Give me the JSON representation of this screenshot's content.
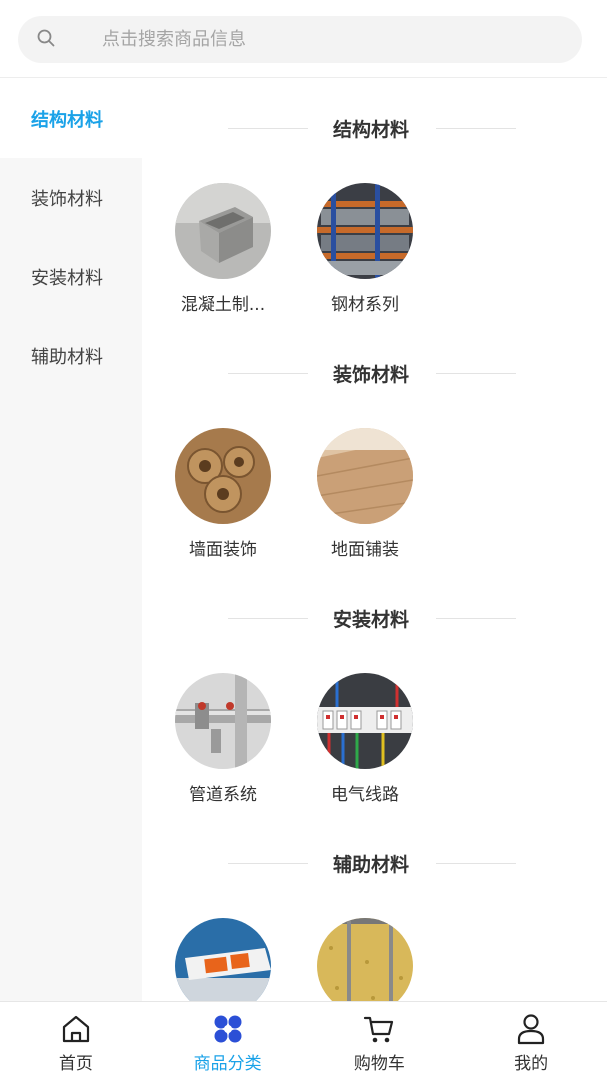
{
  "search": {
    "placeholder": "点击搜索商品信息",
    "icon": "search-icon"
  },
  "sidebar": {
    "items": [
      {
        "label": "结构材料",
        "active": true
      },
      {
        "label": "装饰材料",
        "active": false
      },
      {
        "label": "安装材料",
        "active": false
      },
      {
        "label": "辅助材料",
        "active": false
      }
    ]
  },
  "sections": [
    {
      "title": "结构材料",
      "items": [
        {
          "label": "混凝土制..."
        },
        {
          "label": "钢材系列"
        }
      ]
    },
    {
      "title": "装饰材料",
      "items": [
        {
          "label": "墙面装饰"
        },
        {
          "label": "地面铺装"
        }
      ]
    },
    {
      "title": "安装材料",
      "items": [
        {
          "label": "管道系统"
        },
        {
          "label": "电气线路"
        }
      ]
    },
    {
      "title": "辅助材料",
      "items": [
        {
          "label": ""
        },
        {
          "label": ""
        }
      ]
    }
  ],
  "tabbar": {
    "tabs": [
      {
        "label": "首页",
        "icon": "home-icon",
        "active": false
      },
      {
        "label": "商品分类",
        "icon": "category-icon",
        "active": true
      },
      {
        "label": "购物车",
        "icon": "cart-icon",
        "active": false
      },
      {
        "label": "我的",
        "icon": "user-icon",
        "active": false
      }
    ]
  },
  "colors": {
    "accent": "#1aa2e8",
    "sidebar_bg": "#f7f7f7",
    "category_icon": "#2b4fd6"
  }
}
